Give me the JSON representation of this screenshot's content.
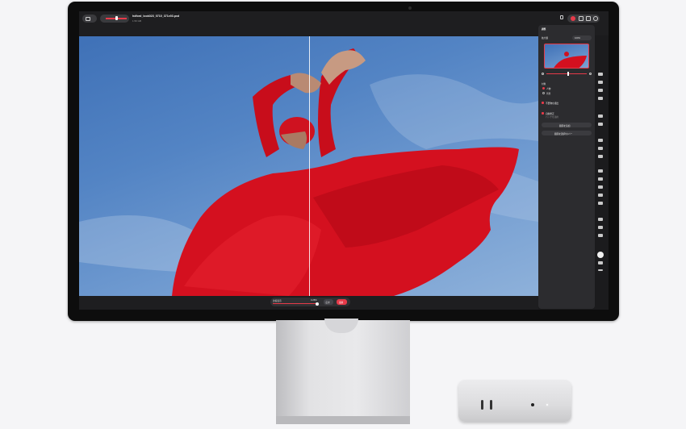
{
  "app": {
    "filename": "hdford_look023_0710_371v03.pxd",
    "file_subtitle": "1.50 GB",
    "zoom_label": "ズーム"
  },
  "panel": {
    "title": "調整",
    "preset_label": "拡大鏡",
    "preset_value": "100%",
    "section_label": "対象",
    "option_1": "人物",
    "option_2": "背景",
    "check_1": "不要物を検出",
    "check_2": "自動修正",
    "check_2_sub": "パッチを適用",
    "button_1": "範囲を追加",
    "button_2": "範囲を選択/ホバー"
  },
  "bottombar": {
    "compare_label": "比較表示",
    "value": "0.25%",
    "secondary_button": "戻す",
    "primary_button": "適用"
  },
  "colors": {
    "accent": "#e63a49",
    "sky": "#4f80c2",
    "dress": "#d4101f"
  },
  "icons": [
    "sidebar-toggle-icon",
    "share-icon",
    "record-icon",
    "window-icon",
    "panel-icon",
    "zoom-icon",
    "cursor-icon",
    "brush-icon",
    "eraser-icon",
    "lasso-icon",
    "stamp-icon",
    "heal-icon",
    "crop-icon",
    "type-icon",
    "shape-icon",
    "pen-icon",
    "eyedropper-icon",
    "layers-icon",
    "magic-wand-icon",
    "more-icon"
  ]
}
